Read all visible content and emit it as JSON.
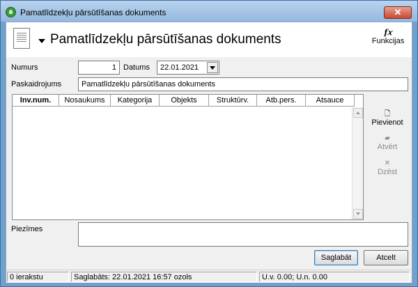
{
  "window": {
    "title": "Pamatlīdzekļu pārsūtīšanas dokuments",
    "close_symbol": "✕"
  },
  "header": {
    "title": "Pamatlīdzekļu pārsūtīšanas dokuments",
    "functions_label": "Funkcijas",
    "functions_icon": "fx-icon",
    "functions_glyph": "f𝑥"
  },
  "form": {
    "number_label": "Numurs",
    "number_value": "1",
    "date_label": "Datums",
    "date_value": "22.01.2021",
    "description_label": "Paskaidrojums",
    "description_value": "Pamatlīdzekļu pārsūtīšanas dokuments",
    "notes_label": "Piezīmes",
    "notes_value": ""
  },
  "grid": {
    "columns": [
      "Inv.num.",
      "Nosaukums",
      "Kategorija",
      "Objekts",
      "Struktūrv.",
      "Atb.pers.",
      "Atsauce"
    ],
    "rows": []
  },
  "side_actions": {
    "add": {
      "label": "Pievienot",
      "icon": "document-icon",
      "glyph": "🗋"
    },
    "open": {
      "label": "Atvērt",
      "icon": "folder-icon",
      "glyph": "▰"
    },
    "delete": {
      "label": "Dzēst",
      "icon": "close-icon",
      "glyph": "✕"
    }
  },
  "buttons": {
    "save": "Saglabāt",
    "cancel": "Atcelt"
  },
  "status": {
    "records": "0 ierakstu",
    "saved": "Saglabāts: 22.01.2021 16:57 ozols",
    "totals": "U.v. 0.00; U.n. 0.00"
  }
}
